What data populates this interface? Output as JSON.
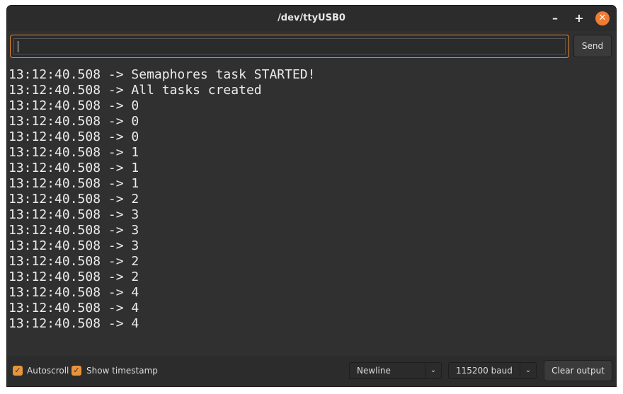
{
  "window": {
    "title": "/dev/ttyUSB0",
    "controls": {
      "minimize": "–",
      "maximize": "+",
      "close": "✕"
    }
  },
  "input": {
    "value": "",
    "send_label": "Send"
  },
  "output": {
    "lines": [
      "13:12:40.508 -> Semaphores task STARTED!",
      "13:12:40.508 -> All tasks created",
      "13:12:40.508 -> 0",
      "13:12:40.508 -> 0",
      "13:12:40.508 -> 0",
      "13:12:40.508 -> 1",
      "13:12:40.508 -> 1",
      "13:12:40.508 -> 1",
      "13:12:40.508 -> 2",
      "13:12:40.508 -> 3",
      "13:12:40.508 -> 3",
      "13:12:40.508 -> 3",
      "13:12:40.508 -> 2",
      "13:12:40.508 -> 2",
      "13:12:40.508 -> 4",
      "13:12:40.508 -> 4",
      "13:12:40.508 -> 4"
    ]
  },
  "statusbar": {
    "autoscroll": {
      "label": "Autoscroll",
      "checked": true
    },
    "show_timestamp": {
      "label": "Show timestamp",
      "checked": true
    },
    "line_ending": {
      "selected": "Newline"
    },
    "baud_rate": {
      "selected": "115200 baud"
    },
    "clear_label": "Clear output"
  },
  "colors": {
    "accent": "#e8943a",
    "background": "#303030",
    "text": "#ececec"
  }
}
